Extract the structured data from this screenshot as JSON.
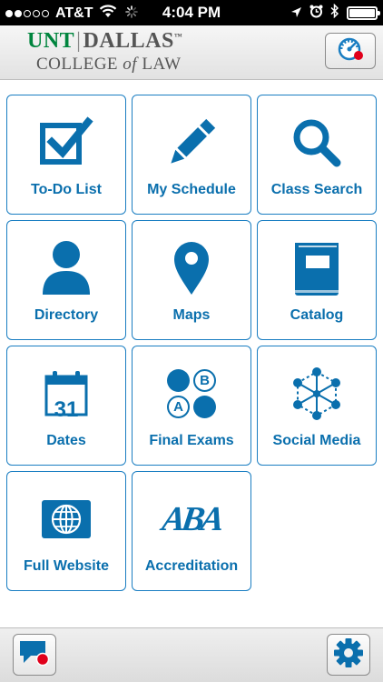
{
  "status_bar": {
    "carrier": "AT&T",
    "time": "4:04 PM",
    "signal_icon": "signal-dots-icon",
    "wifi_icon": "wifi-icon",
    "loading_icon": "activity-spinner-icon",
    "location_icon": "location-arrow-icon",
    "alarm_icon": "alarm-clock-icon",
    "bluetooth_icon": "bluetooth-icon",
    "battery_icon": "battery-icon"
  },
  "header": {
    "logo_unt": "UNT",
    "logo_dallas": "DALLAS",
    "logo_tm": "™",
    "logo_college": "COLLEGE",
    "logo_of": "of",
    "logo_law": "LAW",
    "dashboard_icon": "speedometer-icon"
  },
  "tiles": [
    {
      "label": "To-Do List",
      "icon": "checkbox-icon"
    },
    {
      "label": "My Schedule",
      "icon": "pencil-icon"
    },
    {
      "label": "Class Search",
      "icon": "magnifier-icon"
    },
    {
      "label": "Directory",
      "icon": "person-icon"
    },
    {
      "label": "Maps",
      "icon": "map-pin-icon"
    },
    {
      "label": "Catalog",
      "icon": "book-icon"
    },
    {
      "label": "Dates",
      "icon": "calendar-icon",
      "calendar_day": "31"
    },
    {
      "label": "Final Exams",
      "icon": "answer-bubbles-icon",
      "bubble_a": "A",
      "bubble_b": "B"
    },
    {
      "label": "Social Media",
      "icon": "network-icon"
    },
    {
      "label": "Full Website",
      "icon": "globe-icon"
    },
    {
      "label": "Accreditation",
      "icon": "aba-logo-icon",
      "logo_text": "ABA"
    }
  ],
  "footer": {
    "chat_icon": "chat-bubble-icon",
    "settings_icon": "gear-icon"
  },
  "colors": {
    "accent": "#0a6fad",
    "tile_border": "#1a7ec2",
    "logo_green": "#00853e",
    "badge_red": "#e0001b"
  }
}
